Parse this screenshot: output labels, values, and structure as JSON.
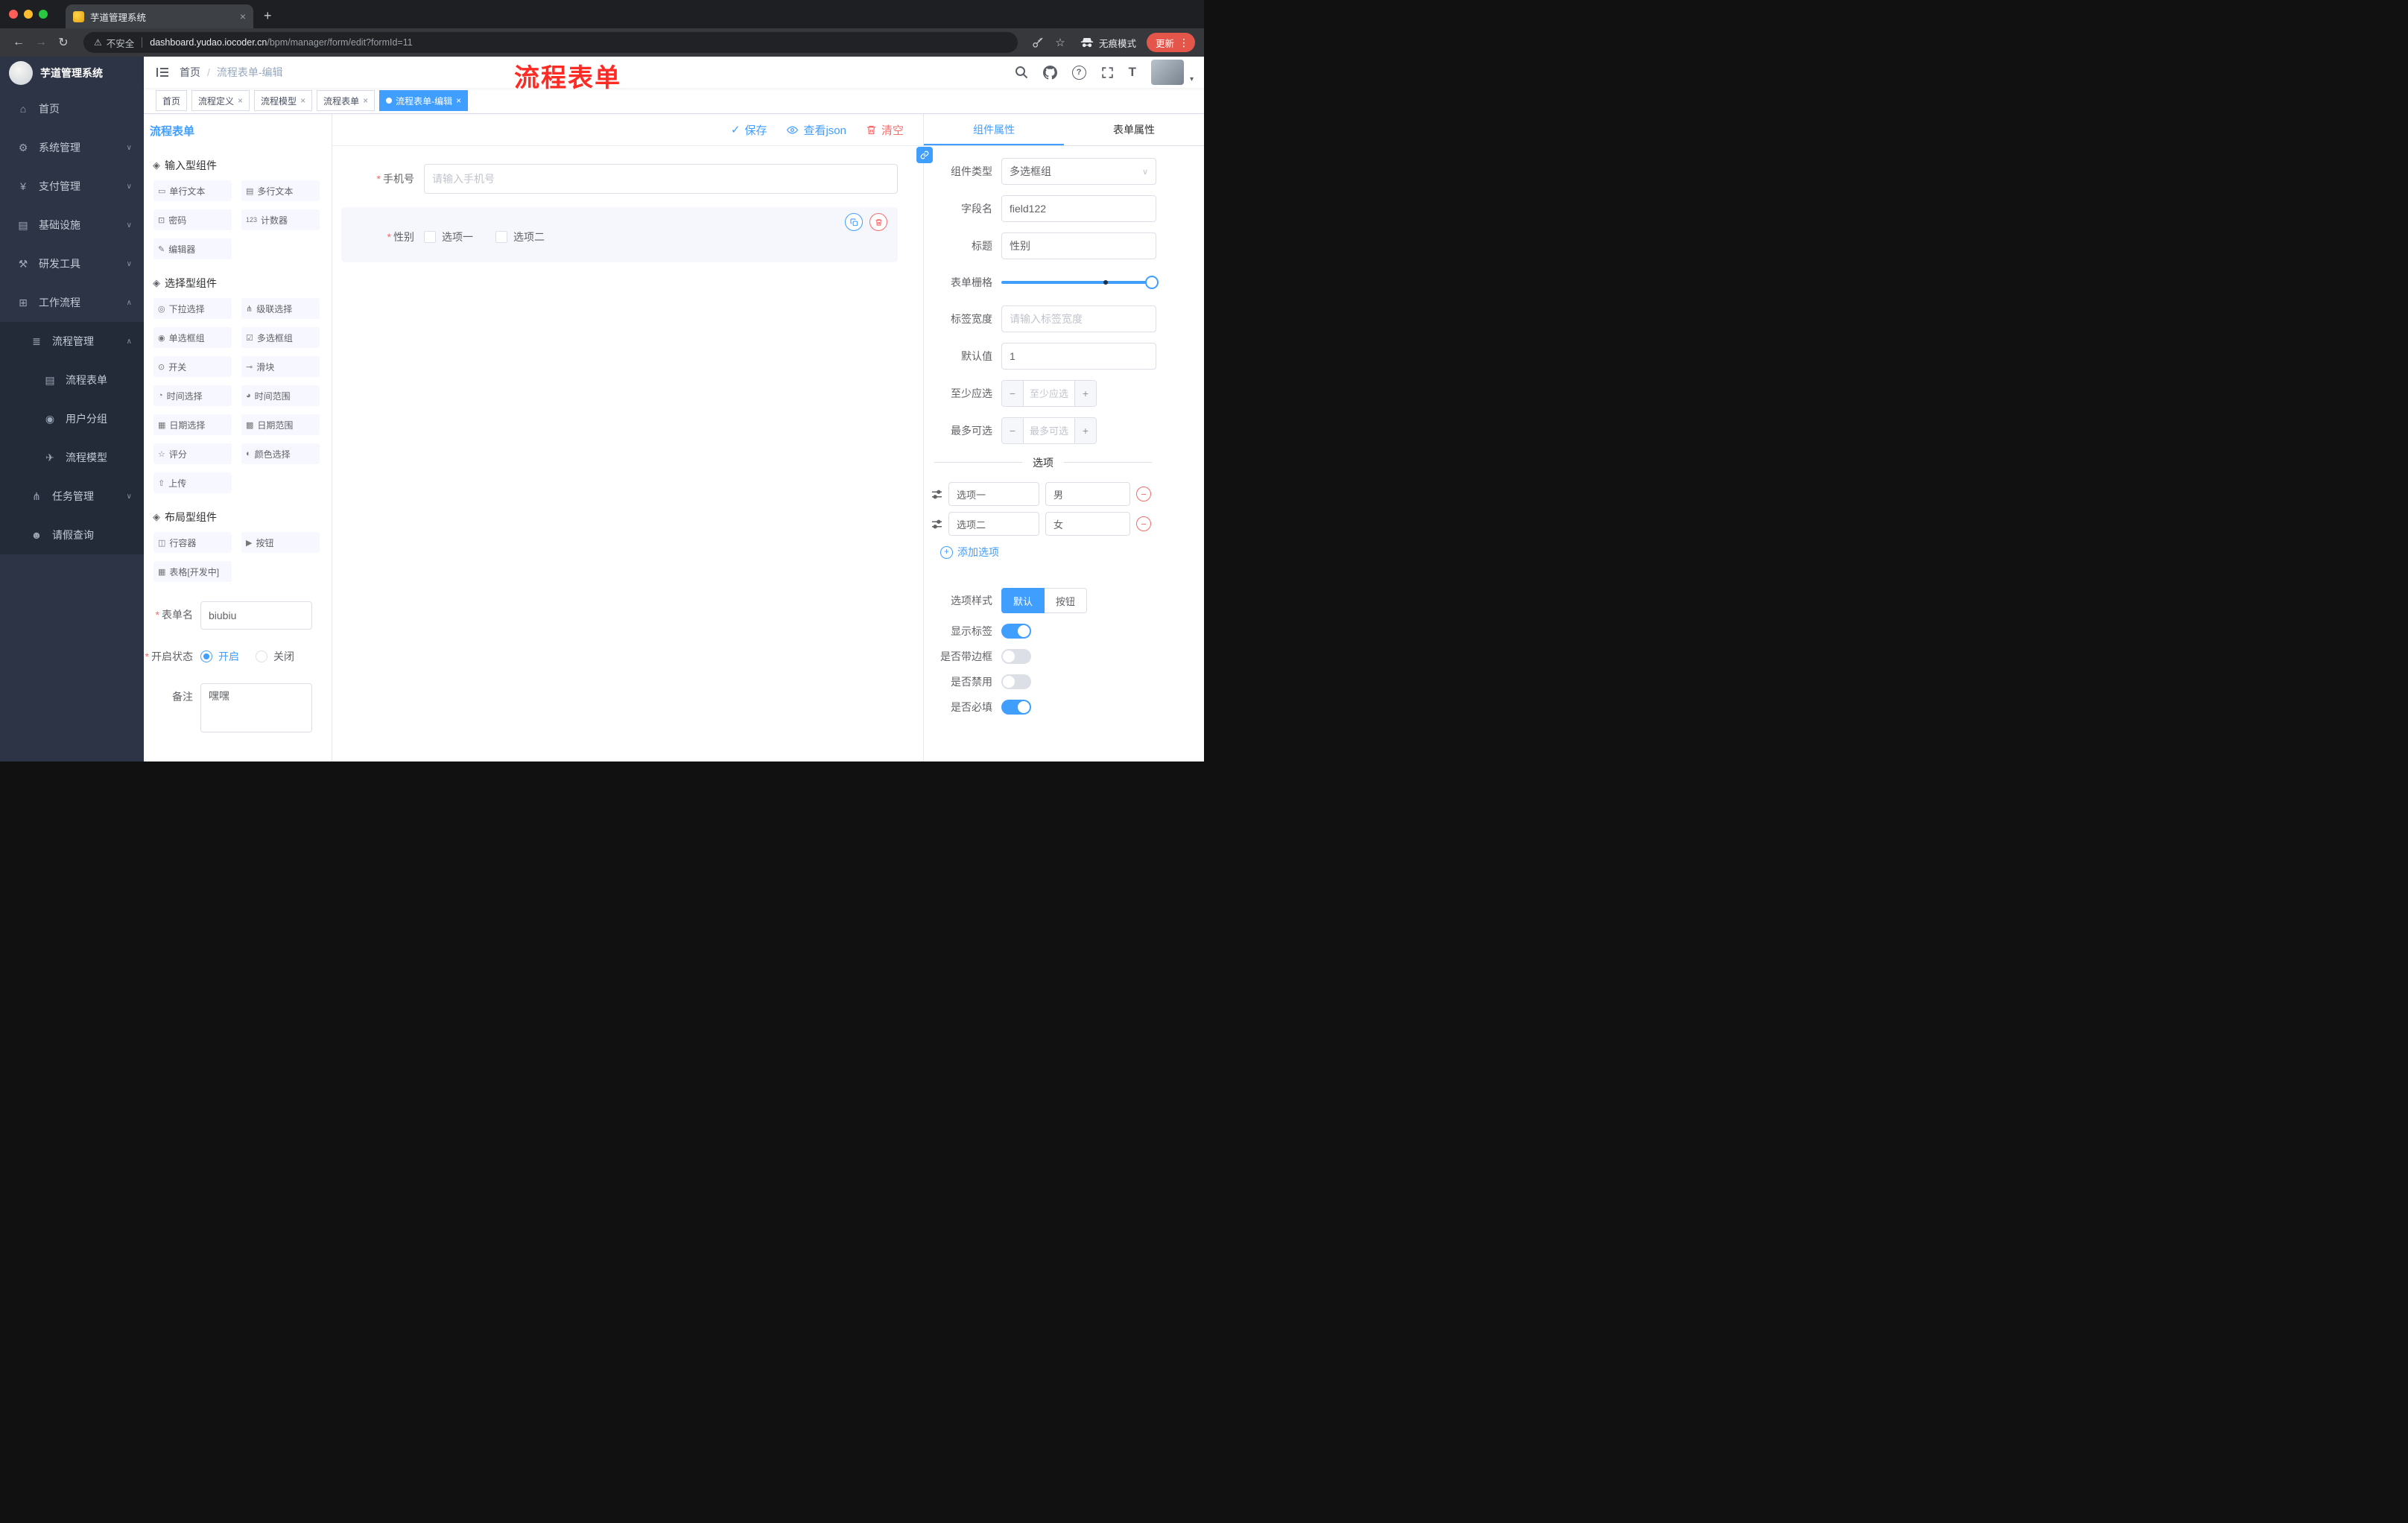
{
  "icons": {
    "close": "×",
    "plus": "+",
    "back": "←",
    "forward": "→",
    "reload": "↻",
    "warning": "⚠",
    "star": "☆",
    "more": "⋮",
    "caret_down": "∨",
    "caret_up": "∧",
    "caret_small": "▾",
    "check": "✓",
    "question": "?",
    "fontsize": "T",
    "minus": "−",
    "required": "*",
    "group": "◈"
  },
  "browser": {
    "tab_title": "芋道管理系统",
    "security_text": "不安全",
    "url_domain": "dashboard.yudao.iocoder.cn",
    "url_path": "/bpm/manager/form/edit?formId=11",
    "incognito_label": "无痕模式",
    "update_label": "更新"
  },
  "sidebar": {
    "logo_title": "芋道管理系统",
    "items": [
      {
        "icon": "⌂",
        "label": "首页"
      },
      {
        "icon": "⚙",
        "label": "系统管理"
      },
      {
        "icon": "¥",
        "label": "支付管理"
      },
      {
        "icon": "▤",
        "label": "基础设施"
      },
      {
        "icon": "⚒",
        "label": "研发工具"
      },
      {
        "icon": "⊞",
        "label": "工作流程"
      },
      {
        "icon": "≣",
        "label": "流程管理"
      },
      {
        "icon": "▤",
        "label": "流程表单"
      },
      {
        "icon": "◉",
        "label": "用户分组"
      },
      {
        "icon": "✈",
        "label": "流程模型"
      },
      {
        "icon": "⋔",
        "label": "任务管理"
      },
      {
        "icon": "☻",
        "label": "请假查询"
      }
    ]
  },
  "navbar": {
    "breadcrumb_home": "首页",
    "breadcrumb_sep": "/",
    "breadcrumb_current": "流程表单-编辑",
    "overlay_title": "流程表单"
  },
  "tags": [
    {
      "label": "首页"
    },
    {
      "label": "流程定义"
    },
    {
      "label": "流程模型"
    },
    {
      "label": "流程表单"
    },
    {
      "label": "流程表单-编辑"
    }
  ],
  "palette": {
    "title": "流程表单",
    "groups": [
      {
        "icon": "◈",
        "title": "输入型组件",
        "items": [
          {
            "icon": "▭",
            "label": "单行文本"
          },
          {
            "icon": "▤",
            "label": "多行文本"
          },
          {
            "icon": "⊡",
            "label": "密码"
          },
          {
            "icon": "123",
            "label": "计数器"
          },
          {
            "icon": "✎",
            "label": "编辑器"
          }
        ]
      },
      {
        "icon": "◈",
        "title": "选择型组件",
        "items": [
          {
            "icon": "◎",
            "label": "下拉选择"
          },
          {
            "icon": "⋔",
            "label": "级联选择"
          },
          {
            "icon": "◉",
            "label": "单选框组"
          },
          {
            "icon": "☑",
            "label": "多选框组"
          },
          {
            "icon": "⊙",
            "label": "开关"
          },
          {
            "icon": "⊸",
            "label": "滑块"
          },
          {
            "icon": "◔",
            "label": "时间选择"
          },
          {
            "icon": "◕",
            "label": "时间范围"
          },
          {
            "icon": "▦",
            "label": "日期选择"
          },
          {
            "icon": "▩",
            "label": "日期范围"
          },
          {
            "icon": "☆",
            "label": "评分"
          },
          {
            "icon": "◐",
            "label": "颜色选择"
          },
          {
            "icon": "⇧",
            "label": "上传"
          }
        ]
      },
      {
        "icon": "◈",
        "title": "布局型组件",
        "items": [
          {
            "icon": "◫",
            "label": "行容器"
          },
          {
            "icon": "▶",
            "label": "按钮"
          },
          {
            "icon": "▦",
            "label": "表格[开发中]"
          }
        ]
      }
    ],
    "form": {
      "name_label": "表单名",
      "name_value": "biubiu",
      "status_label": "开启状态",
      "status_on": "开启",
      "status_off": "关闭",
      "remark_label": "备注",
      "remark_value": "嘿嘿"
    }
  },
  "canvas": {
    "toolbar": {
      "save": "保存",
      "view_json": "查看json",
      "clear": "清空"
    },
    "phone": {
      "label": "手机号",
      "placeholder": "请输入手机号"
    },
    "gender": {
      "label": "性别",
      "option1": "选项一",
      "option2": "选项二"
    }
  },
  "inspector": {
    "tab_component": "组件属性",
    "tab_form": "表单属性",
    "component_type_label": "组件类型",
    "component_type_value": "多选框组",
    "field_name_label": "字段名",
    "field_name_value": "field122",
    "title_label": "标题",
    "title_value": "性别",
    "grid_label": "表单栅格",
    "label_width_label": "标签宽度",
    "label_width_placeholder": "请输入标签宽度",
    "default_label": "默认值",
    "default_value": "1",
    "min_label": "至少应选",
    "min_placeholder": "至少应选",
    "max_label": "最多可选",
    "max_placeholder": "最多可选",
    "options_divider": "选项",
    "options": [
      {
        "label": "选项一",
        "value": "男"
      },
      {
        "label": "选项二",
        "value": "女"
      }
    ],
    "add_option": "添加选项",
    "option_style_label": "选项样式",
    "option_style_default": "默认",
    "option_style_button": "按钮",
    "toggle_show_label": "显示标签",
    "toggle_border": "是否带边框",
    "toggle_disabled": "是否禁用",
    "toggle_required": "是否必填"
  }
}
